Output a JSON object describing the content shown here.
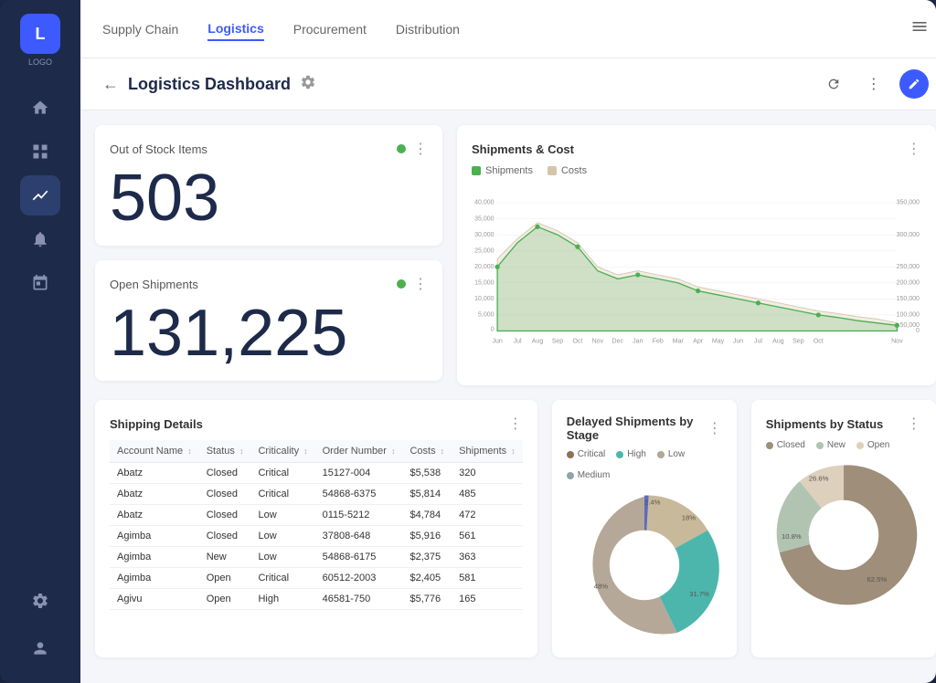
{
  "app": {
    "logo_letter": "L",
    "logo_subtitle": "LOGO"
  },
  "nav": {
    "items": [
      {
        "label": "Supply Chain",
        "active": false
      },
      {
        "label": "Logistics",
        "active": true
      },
      {
        "label": "Procurement",
        "active": false
      },
      {
        "label": "Distribution",
        "active": false
      }
    ]
  },
  "page": {
    "title": "Logistics Dashboard",
    "back_label": "←"
  },
  "metrics": {
    "out_of_stock": {
      "label": "Out of Stock Items",
      "value": "503"
    },
    "open_shipments": {
      "label": "Open Shipments",
      "value": "131,225"
    }
  },
  "chart": {
    "title": "Shipments & Cost",
    "legend_shipments": "Shipments",
    "legend_costs": "Costs",
    "x_labels": [
      "Jun",
      "Jul",
      "Aug",
      "Sep",
      "Oct",
      "Nov",
      "Dec",
      "Jan",
      "Feb",
      "Mar",
      "Apr",
      "May",
      "Jun",
      "Jul",
      "Aug",
      "Sep",
      "Oct",
      "Nov"
    ]
  },
  "shipping_details": {
    "title": "Shipping Details",
    "columns": [
      "Account Name",
      "Status",
      "Criticality",
      "Order Number",
      "Costs",
      "Shipments"
    ],
    "rows": [
      {
        "account": "Abatz",
        "status": "Closed",
        "criticality": "Critical",
        "order": "15127-004",
        "costs": "$5,538",
        "shipments": "320"
      },
      {
        "account": "Abatz",
        "status": "Closed",
        "criticality": "Critical",
        "order": "54868-6375",
        "costs": "$5,814",
        "shipments": "485"
      },
      {
        "account": "Abatz",
        "status": "Closed",
        "criticality": "Low",
        "order": "0115-5212",
        "costs": "$4,784",
        "shipments": "472"
      },
      {
        "account": "Agimba",
        "status": "Closed",
        "criticality": "Low",
        "order": "37808-648",
        "costs": "$5,916",
        "shipments": "561"
      },
      {
        "account": "Agimba",
        "status": "New",
        "criticality": "Low",
        "order": "54868-6175",
        "costs": "$2,375",
        "shipments": "363"
      },
      {
        "account": "Agimba",
        "status": "Open",
        "criticality": "Critical",
        "order": "60512-2003",
        "costs": "$2,405",
        "shipments": "581"
      },
      {
        "account": "Agivu",
        "status": "Open",
        "criticality": "High",
        "order": "46581-750",
        "costs": "$5,776",
        "shipments": "165"
      }
    ]
  },
  "delayed_shipments": {
    "title": "Delayed Shipments by Stage",
    "legend": [
      {
        "label": "Critical",
        "color": "#8b7355"
      },
      {
        "label": "High",
        "color": "#4db6ac"
      },
      {
        "label": "Low",
        "color": "#b0a898"
      },
      {
        "label": "Medium",
        "color": "#90a4ae"
      }
    ],
    "segments": [
      {
        "label": "18%",
        "value": 18,
        "color": "#c8b99a"
      },
      {
        "label": "31.7%",
        "value": 31.7,
        "color": "#4db6ac"
      },
      {
        "label": "48%",
        "value": 48,
        "color": "#b5a898"
      },
      {
        "label": "2.4%",
        "value": 2.4,
        "color": "#5c6bc0"
      }
    ]
  },
  "shipments_by_status": {
    "title": "Shipments by Status",
    "legend": [
      {
        "label": "Closed",
        "color": "#9e8e7a"
      },
      {
        "label": "New",
        "color": "#b0c4b1"
      },
      {
        "label": "Open",
        "color": "#cfc0a8"
      }
    ],
    "segments": [
      {
        "label": "62.5%",
        "value": 62.5,
        "color": "#9e8e7a"
      },
      {
        "label": "10.8%",
        "value": 10.8,
        "color": "#b0c4b1"
      },
      {
        "label": "26.6%",
        "value": 26.6,
        "color": "#ddd0bd"
      }
    ]
  }
}
